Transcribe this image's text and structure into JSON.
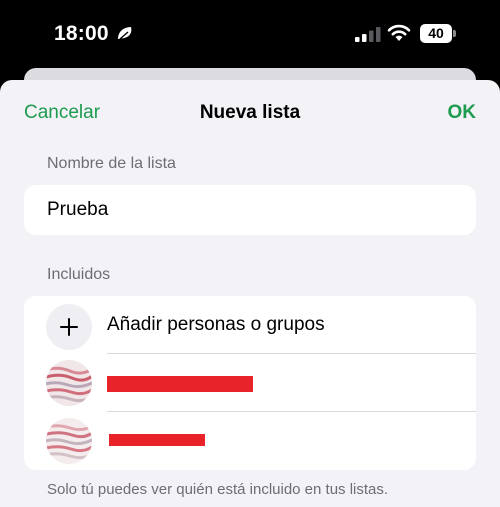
{
  "status_bar": {
    "time": "18:00",
    "battery_level": "40",
    "icons": [
      "focus-mode-icon",
      "cellular-signal-icon",
      "wifi-icon",
      "battery-icon"
    ]
  },
  "nav": {
    "cancel_label": "Cancelar",
    "title": "Nueva lista",
    "ok_label": "OK"
  },
  "form": {
    "name_section_label": "Nombre de la lista",
    "name_value": "Prueba",
    "included_section_label": "Incluidos",
    "add_people_label": "Añadir personas o grupos",
    "members": [
      {
        "name": "",
        "redacted": true
      },
      {
        "name": "",
        "redacted": true
      }
    ],
    "footer_note": "Solo tú puedes ver quién está incluido en tus listas."
  },
  "colors": {
    "accent": "#1d9b4f",
    "background": "#f2f2f7",
    "card": "#ffffff",
    "secondary_text": "#6d6d72",
    "redaction": "#e8232a"
  }
}
